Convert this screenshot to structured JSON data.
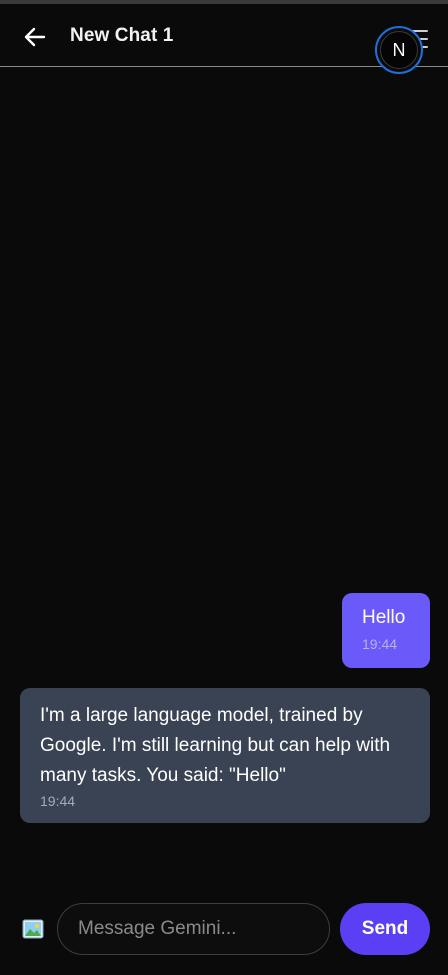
{
  "header": {
    "title": "New Chat 1",
    "avatar_letter": "N",
    "back_icon": "arrow-left-icon",
    "menu_icon": "hamburger-menu-icon"
  },
  "messages": [
    {
      "role": "user",
      "text": "Hello",
      "time": "19:44"
    },
    {
      "role": "assistant",
      "text": "I'm a large language model, trained by Google. I'm still learning but can help with many tasks. You said: \"Hello\"",
      "time": "19:44"
    }
  ],
  "composer": {
    "image_icon": "image-picture-icon",
    "placeholder": "Message Gemini...",
    "value": "",
    "send_label": "Send"
  },
  "colors": {
    "background": "#0a0a0a",
    "user_bubble": "#6a5af9",
    "assistant_bubble": "#3a4353",
    "send_button": "#5b3ff4",
    "avatar_ring": "#1f6fd9"
  }
}
